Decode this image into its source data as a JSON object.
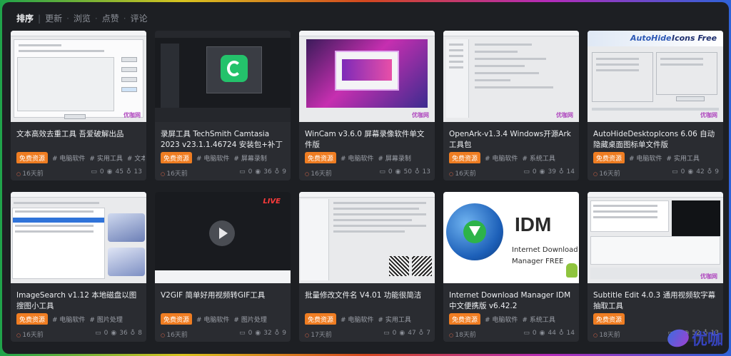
{
  "sortbar": {
    "items": [
      "排序",
      "更新",
      "浏览",
      "点赞",
      "评论"
    ]
  },
  "cards": [
    {
      "title": "文本高效去重工具 吾爱破解出品",
      "tags": [
        "免费资源",
        "# 电脑软件",
        "# 实用工具",
        "# 文本"
      ],
      "time": "16天前",
      "comments": "0",
      "views": "45",
      "likes": "13"
    },
    {
      "title": "录屏工具 TechSmith Camtasia 2023 v23.1.1.46724 安装包+补丁版",
      "tags": [
        "免费资源",
        "# 电脑软件",
        "# 屏幕录制"
      ],
      "time": "16天前",
      "comments": "0",
      "views": "36",
      "likes": "9"
    },
    {
      "title": "WinCam v3.6.0 屏幕录像软件单文件版",
      "tags": [
        "免费资源",
        "# 电脑软件",
        "# 屏幕录制"
      ],
      "time": "16天前",
      "comments": "0",
      "views": "50",
      "likes": "13"
    },
    {
      "title": "OpenArk-v1.3.4 Windows开源Ark工具包",
      "tags": [
        "免费资源",
        "# 电脑软件",
        "# 系统工具"
      ],
      "time": "16天前",
      "comments": "0",
      "views": "39",
      "likes": "14"
    },
    {
      "title": "AutoHideDesktopIcons 6.06 自动隐藏桌面图标单文件版",
      "tags": [
        "免费资源",
        "# 电脑软件",
        "# 实用工具"
      ],
      "time": "16天前",
      "comments": "0",
      "views": "42",
      "likes": "9"
    },
    {
      "title": "ImageSearch v1.12 本地磁盘以图搜图小工具",
      "tags": [
        "免费资源",
        "# 电脑软件",
        "# 图片处理"
      ],
      "time": "16天前",
      "comments": "0",
      "views": "36",
      "likes": "8"
    },
    {
      "title": "V2GIF 简单好用视频转GIF工具",
      "tags": [
        "免费资源",
        "# 电脑软件",
        "# 图片处理"
      ],
      "time": "16天前",
      "comments": "0",
      "views": "32",
      "likes": "9"
    },
    {
      "title": "批量修改文件名 V4.01 功能很简洁",
      "tags": [
        "免费资源",
        "# 电脑软件",
        "# 实用工具"
      ],
      "time": "17天前",
      "comments": "0",
      "views": "47",
      "likes": "7"
    },
    {
      "title": "Internet Download Manager IDM 中文便携版 v6.42.2",
      "tags": [
        "免费资源",
        "# 电脑软件",
        "# 系统工具"
      ],
      "time": "18天前",
      "comments": "0",
      "views": "44",
      "likes": "14"
    },
    {
      "title": "Subtitle Edit 4.0.3 通用视频软字幕抽取工具",
      "tags": [
        "免费资源"
      ],
      "time": "18天前",
      "comments": "0",
      "views": "52",
      "likes": "13"
    }
  ],
  "thumbs": {
    "idm_big": "IDM",
    "idm_line1": "Internet Download",
    "idm_line2": "Manager FREE",
    "autohide_banner": "AutoHide",
    "autohide_banner2": "Icons Free",
    "live_badge": "LIVE",
    "watermark": "优咖网",
    "corner_logo": "优咖"
  },
  "colors": {
    "accent_orange": "#ef7d22",
    "card_bg": "#2a2c31",
    "page_bg": "#1d1f23"
  }
}
